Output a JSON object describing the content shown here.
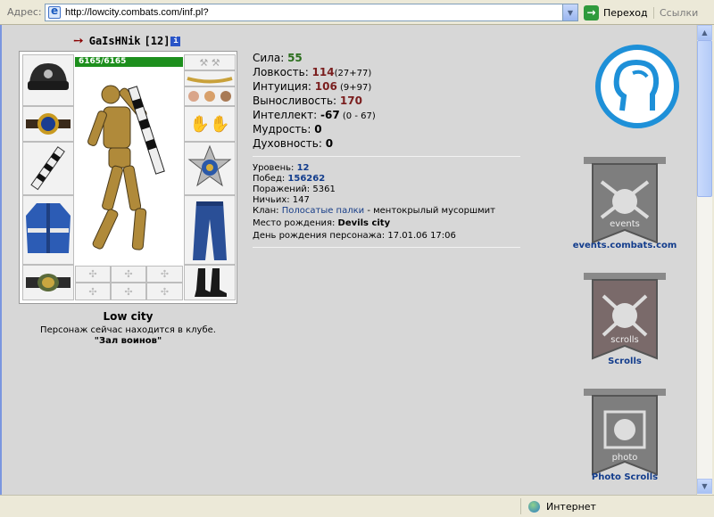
{
  "browser": {
    "address_label": "Адрес:",
    "url": "http://lowcity.combats.com/inf.pl?",
    "go_label": "Переход",
    "links_label": "Ссылки",
    "zone_label": "Интернет"
  },
  "character": {
    "name": "GaIsHNik",
    "level_tag": "[12]",
    "hp": "6165/6165"
  },
  "location": {
    "city": "Low city",
    "line": "Персонаж сейчас находится в клубе.",
    "room": "\"Зал воинов\""
  },
  "stats": [
    {
      "label": "Сила: ",
      "value": "55",
      "extra": "",
      "color": "green"
    },
    {
      "label": "Ловкость: ",
      "value": "114",
      "extra": "(27+77)",
      "color": "red"
    },
    {
      "label": "Интуиция: ",
      "value": "106",
      "extra": " (9+97)",
      "color": "red"
    },
    {
      "label": "Выносливость: ",
      "value": "170",
      "extra": "",
      "color": "red"
    },
    {
      "label": "Интеллект: ",
      "value": "-67",
      "extra": " (0 - 67)",
      "color": "black"
    },
    {
      "label": "Мудрость: ",
      "value": "0",
      "extra": "",
      "color": "black"
    },
    {
      "label": "Духовность: ",
      "value": "0",
      "extra": "",
      "color": "black"
    }
  ],
  "info": {
    "level_label": "Уровень: ",
    "level": "12",
    "wins_label": "Побед: ",
    "wins": "156262",
    "losses_label": "Поражений: ",
    "losses": "5361",
    "draws_label": "Ничьих: ",
    "draws": "147",
    "clan_label": "Клан: ",
    "clan": "Полосатые палки",
    "clan_rank": " - ментокрылый мусоршмит",
    "birthplace_label": "Место рождения: ",
    "birthplace": "Devils city",
    "birthday_label": "День рождения персонажа: ",
    "birthday": "17.01.06 17:06"
  },
  "sidebar": {
    "banners": [
      {
        "label": "events.combats.com",
        "tag": "events"
      },
      {
        "label": "Scrolls",
        "tag": "scrolls"
      },
      {
        "label": "Photo Scrolls",
        "tag": "photo"
      }
    ]
  },
  "colors": {
    "hp_bar": "#1d8f1d",
    "logo_ring": "#1e90d8",
    "stat_green": "#2b6e1d",
    "stat_red": "#7a1e1e",
    "link_blue": "#123c8c"
  }
}
